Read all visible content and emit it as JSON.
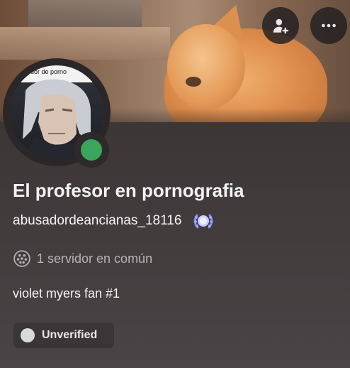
{
  "profile": {
    "display_name": "El profesor en pornografia",
    "username": "abusadordeancianas_18116",
    "avatar_caption": "fesor de porno",
    "status": "online",
    "status_color": "#3ba55c",
    "mutual_servers": "1 servidor en común",
    "bio": "violet myers fan #1",
    "verification": "Unverified"
  },
  "icons": {
    "add_friend": "person-plus-icon",
    "more": "more-horizontal-icon",
    "badge": "nitro-laurel-badge-icon",
    "server": "server-icon"
  },
  "colors": {
    "name": "#f2f3f5",
    "muted": "#b5b3b8",
    "badge": "#9ba6ff"
  }
}
